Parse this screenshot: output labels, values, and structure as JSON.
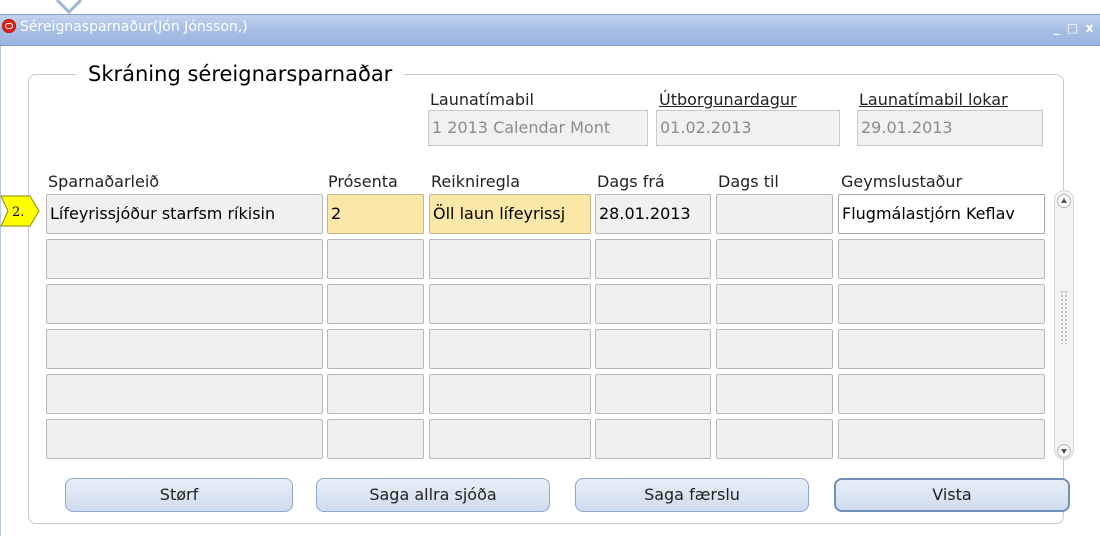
{
  "window": {
    "title": "Séreignasparnaður(Jón Jónsson,)",
    "controls": {
      "minimize": "_",
      "maximize": "□",
      "close": "x"
    }
  },
  "form": {
    "title": "Skráning séreignarsparnaðar",
    "header_fields": [
      {
        "label": "Launatímabil",
        "value": "1 2013 Calendar Mont"
      },
      {
        "label": "Útborgunardagur",
        "value": "01.02.2013"
      },
      {
        "label": "Launatímabil lokar",
        "value": "29.01.2013"
      }
    ]
  },
  "grid": {
    "columns": [
      "Sparnaðarleið",
      "Prósenta",
      "Reikniregla",
      "Dags frá",
      "Dags til",
      "Geymslustaður"
    ],
    "rows": [
      [
        "Lífeyrissjóður starfsm ríkisin",
        "2",
        "Öll laun lífeyrissj",
        "28.01.2013",
        "",
        "Flugmálastjórn Keflav"
      ],
      [
        "",
        "",
        "",
        "",
        "",
        ""
      ],
      [
        "",
        "",
        "",
        "",
        "",
        ""
      ],
      [
        "",
        "",
        "",
        "",
        "",
        ""
      ],
      [
        "",
        "",
        "",
        "",
        "",
        ""
      ],
      [
        "",
        "",
        "",
        "",
        "",
        ""
      ]
    ],
    "row_marker": "2."
  },
  "buttons": {
    "storf": "Størf",
    "saga_allra": "Saga allra sjóða",
    "saga_faerslu": "Saga færslu",
    "vista": "Vista"
  },
  "colors": {
    "titlebar": "#a9c0e6",
    "required_field": "#fbe8a9",
    "marker": "#ffff00"
  }
}
